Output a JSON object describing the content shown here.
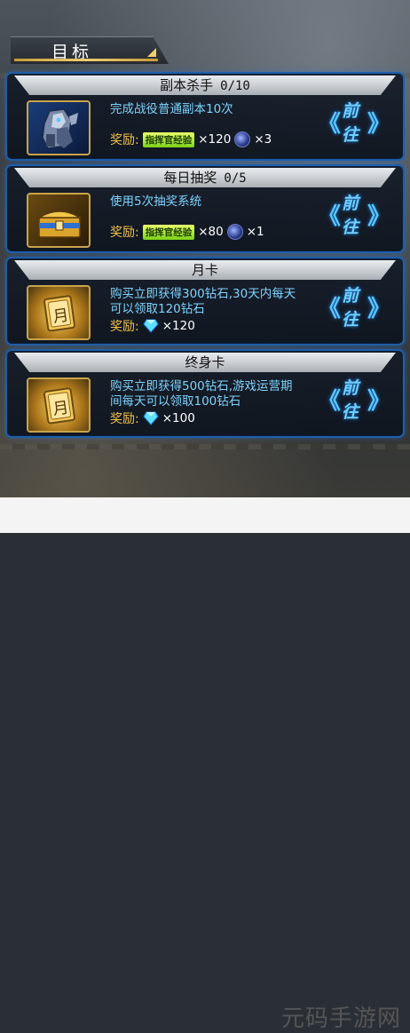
{
  "panel": {
    "title": "目标"
  },
  "tasks": [
    {
      "name": "副本杀手",
      "progress": "0/10",
      "description": "完成战役普通副本10次",
      "reward_label": "奖励:",
      "exp_badge": "指挥官经验",
      "exp_qty": "×120",
      "item_qty": "×3",
      "button": {
        "left": "《",
        "label": "前往",
        "right": "》"
      }
    },
    {
      "name": "每日抽奖",
      "progress": "0/5",
      "description": "使用5次抽奖系统",
      "reward_label": "奖励:",
      "exp_badge": "指挥官经验",
      "exp_qty": "×80",
      "item_qty": "×1",
      "button": {
        "left": "《",
        "label": "前往",
        "right": "》"
      }
    },
    {
      "name": "月卡",
      "description_line1": "购买立即获得300钻石,30天内每天",
      "description_line2": "可以领取120钻石",
      "reward_label": "奖励:",
      "diamond_qty": "×120",
      "icon_char": "月",
      "button": {
        "left": "《",
        "label": "前往",
        "right": "》"
      }
    },
    {
      "name": "终身卡",
      "description_line1": "购买立即获得500钻石,游戏运营期",
      "description_line2": "间每天可以领取100钻石",
      "reward_label": "奖励:",
      "diamond_qty": "×100",
      "icon_char": "月",
      "button": {
        "left": "《",
        "label": "前往",
        "right": "》"
      }
    }
  ],
  "watermark": "元码手游网",
  "colors": {
    "accent_blue": "#59c7ff",
    "gold": "#f2c14a",
    "desc": "#7fd3ff"
  }
}
